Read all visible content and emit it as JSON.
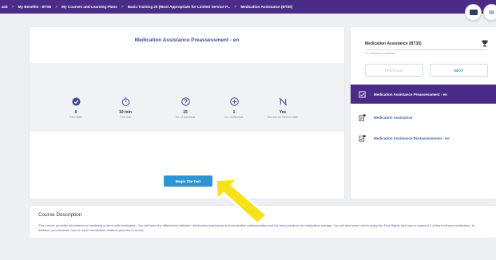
{
  "breadcrumb": [
    "ack",
    "My Benefits - BTS6",
    "My Courses and Learning Plans",
    "Basic Training 20 (Most Appropriate for Limited Service P...",
    "Medication Assistance (BT30)"
  ],
  "assessment": {
    "title": "Medication Assistance Preassessment - en",
    "stats": [
      {
        "icon": "pass-mark-icon",
        "value": "0",
        "label": "Pass Mark"
      },
      {
        "icon": "timer-icon",
        "value": "10 min",
        "label": "Time limit"
      },
      {
        "icon": "questions-icon",
        "value": "15",
        "label": "No. of questions"
      },
      {
        "icon": "attempts-icon",
        "value": "1",
        "label": "No. of attempts"
      },
      {
        "icon": "no-resume-icon",
        "value": "Yes",
        "label": "Test can be resumed later"
      }
    ],
    "begin_label": "Begin The Test"
  },
  "sidebar": {
    "course_name": "Medication Assistance (BT30)",
    "lessons_completed": "0 / 3 lessons completed",
    "previous_label": "PREVIOUS",
    "next_label": "NEXT",
    "lessons": [
      {
        "label": "Medication Assistance Preassessment - en",
        "icon": "assessment-icon",
        "active": true
      },
      {
        "label": "Medication Assistance",
        "icon": "document-icon",
        "active": false
      },
      {
        "label": "Medication Assistance Postassessment - en",
        "icon": "assessment-icon",
        "active": false
      }
    ]
  },
  "description": {
    "title": "Course Description",
    "body": "This course provides information on assisting a client with medication. You will learn the differences between medication assistance and medication administration and the best practices for medication storage. You will also learn how to apply the Five Rights and how to respond if a client refuses medication. In addition, you will learn how to report medication-related concerns or errors."
  },
  "colors": {
    "accent": "#4a2c86",
    "button": "#2e95d3",
    "title": "#3b4f8f",
    "annotation": "#f7e21a"
  }
}
